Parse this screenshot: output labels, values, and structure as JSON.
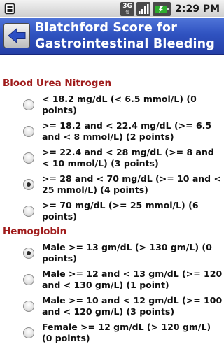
{
  "status_bar": {
    "network": "3G",
    "time": "2:29 PM",
    "icons": [
      "usb-icon",
      "3g-icon",
      "signal-icon",
      "battery-icon"
    ]
  },
  "header": {
    "title": "Blatchford Score for Gastrointestinal Bleeding",
    "back_icon": "back-arrow-icon"
  },
  "sections": {
    "bun": {
      "heading": "Blood Urea Nitrogen",
      "options": [
        {
          "label": "< 18.2 mg/dL (< 6.5 mmol/L) (0 points)",
          "checked": false
        },
        {
          "label": ">= 18.2 and < 22.4 mg/dL (>= 6.5 and < 8 mmol/L) (2 points)",
          "checked": false
        },
        {
          "label": ">= 22.4 and < 28 mg/dL (>= 8 and < 10 mmol/L) (3 points)",
          "checked": false
        },
        {
          "label": ">= 28 and < 70 mg/dL (>= 10 and < 25 mmol/L) (4 points)",
          "checked": true
        },
        {
          "label": ">= 70 mg/dL (>= 25 mmol/L) (6 points)",
          "checked": false
        }
      ]
    },
    "hemoglobin": {
      "heading": "Hemoglobin",
      "options": [
        {
          "label": "Male >= 13 gm/dL (> 130 gm/L) (0 points)",
          "checked": true
        },
        {
          "label": "Male >= 12 and < 13 gm/dL (>= 120 and < 130 gm/L) (1 point)",
          "checked": false
        },
        {
          "label": "Male >= 10 and < 12 gm/dL (>= 100 and < 120 gm/L) (3 points)",
          "checked": false
        },
        {
          "label": "Female >= 12 gm/dL (> 120 gm/L) (0 points)",
          "checked": false
        }
      ]
    }
  },
  "colors": {
    "title_bar": "#2f52c0",
    "section_heading": "#a01c1c"
  }
}
